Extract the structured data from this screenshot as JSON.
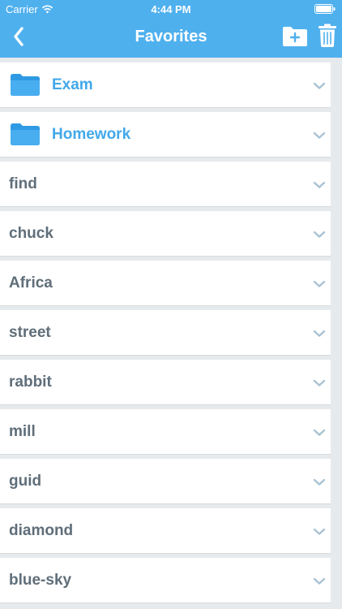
{
  "status_bar": {
    "carrier": "Carrier",
    "time": "4:44 PM",
    "icons": [
      "wifi-icon",
      "battery-icon"
    ]
  },
  "nav": {
    "title": "Favorites",
    "back_icon": "chevron-left-icon",
    "actions": [
      "new-folder-icon",
      "trash-icon"
    ]
  },
  "folders": [
    {
      "label": "Exam",
      "icon": "folder-icon"
    },
    {
      "label": "Homework",
      "icon": "folder-icon"
    }
  ],
  "items": [
    {
      "label": "find"
    },
    {
      "label": "chuck"
    },
    {
      "label": "Africa"
    },
    {
      "label": "street"
    },
    {
      "label": "rabbit"
    },
    {
      "label": "mill"
    },
    {
      "label": "guid"
    },
    {
      "label": "diamond"
    },
    {
      "label": "blue-sky"
    }
  ],
  "colors": {
    "header": "#4fb0ee",
    "folder_text": "#42a8ea",
    "item_text": "#5f6e79",
    "chevron": "#a9c2d3",
    "background": "#e7eaec"
  }
}
